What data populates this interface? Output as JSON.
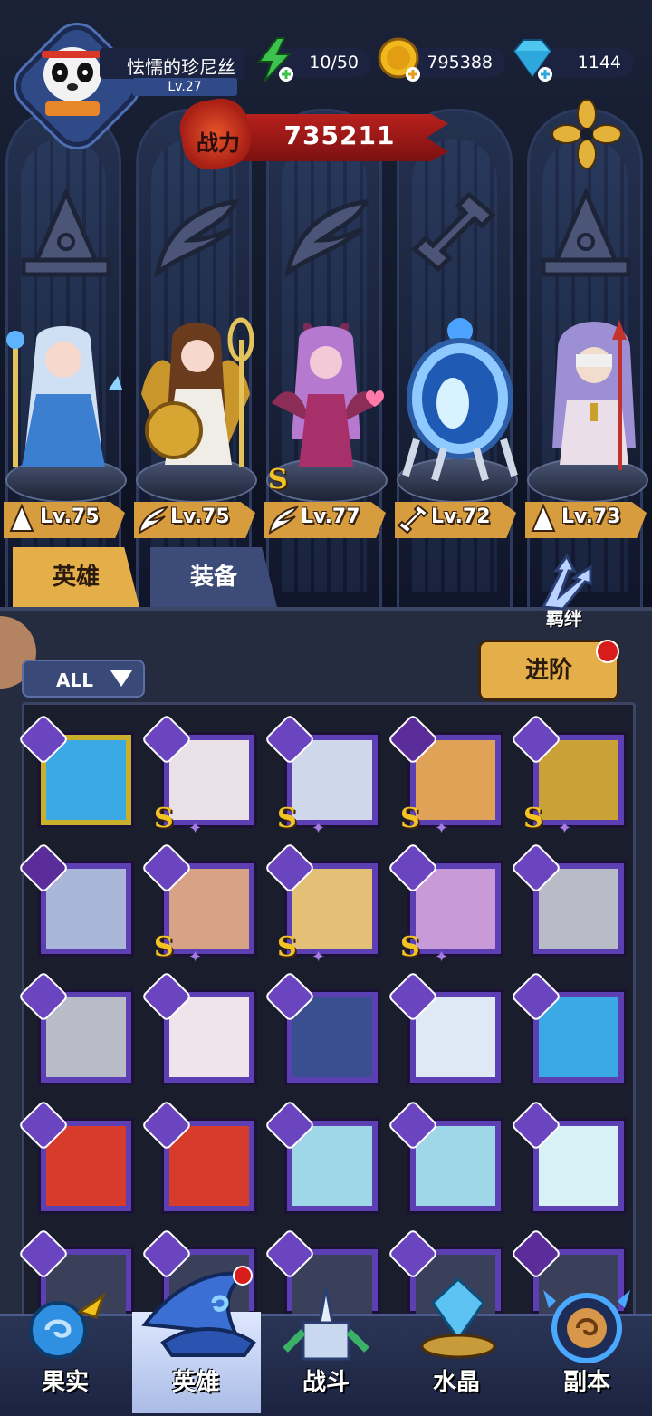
{
  "player": {
    "name": "怯懦的珍尼丝",
    "level": "Lv.27"
  },
  "resources": {
    "energy": "10/50",
    "gold": "795388",
    "diamonds": "1144"
  },
  "power": {
    "label": "战力",
    "value": "735211"
  },
  "lineup": [
    {
      "level": "Lv.75",
      "class_icon": "mage-hat-icon",
      "star": ""
    },
    {
      "level": "Lv.75",
      "class_icon": "wing-icon",
      "star": ""
    },
    {
      "level": "Lv.77",
      "class_icon": "wing-icon",
      "star": "S"
    },
    {
      "level": "Lv.72",
      "class_icon": "wrench-icon",
      "star": ""
    },
    {
      "level": "Lv.73",
      "class_icon": "mage-hat-icon",
      "star": ""
    }
  ],
  "tabs": {
    "heroes": "英雄",
    "equipment": "装备"
  },
  "bond": {
    "label": "羁绊"
  },
  "filter": {
    "label": "ALL"
  },
  "advance": {
    "label": "进阶"
  },
  "grid_badges": {
    "s": "S",
    "star": "✦"
  },
  "nav": {
    "fruit": "果实",
    "heroes": "英雄",
    "battle": "战斗",
    "crystal": "水晶",
    "dungeon": "副本"
  },
  "colors": {
    "gold": "#e4ae49",
    "purple_card": "#5d3fb4",
    "power_red": "#b8201d"
  }
}
